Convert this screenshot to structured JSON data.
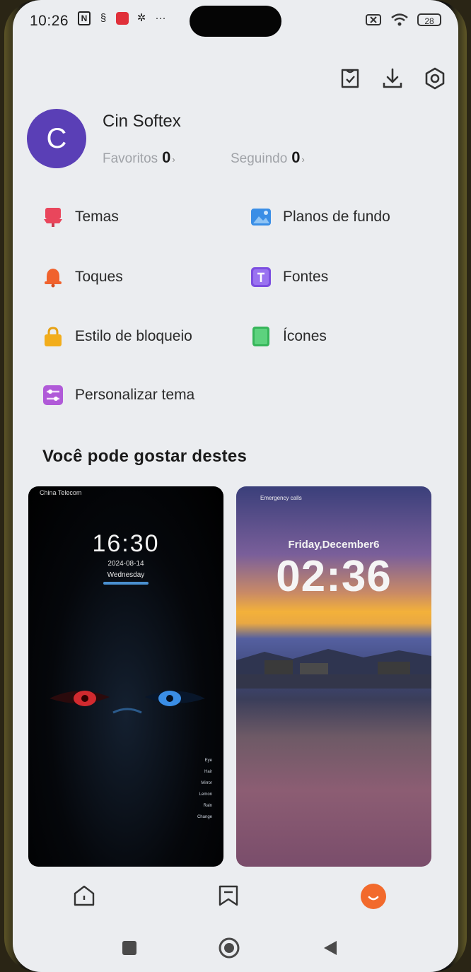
{
  "status_bar": {
    "time": "10:26",
    "battery": "28",
    "dots": "···"
  },
  "profile": {
    "avatar_letter": "C",
    "name": "Cin Softex",
    "favorites_label": "Favoritos",
    "favorites_count": "0",
    "following_label": "Seguindo",
    "following_count": "0"
  },
  "menu": {
    "items": [
      {
        "label": "Temas",
        "icon": "theme-icon",
        "color": "#e9465c"
      },
      {
        "label": "Planos de fundo",
        "icon": "wallpaper-icon",
        "color": "#3a8ee6"
      },
      {
        "label": "Toques",
        "icon": "bell-icon",
        "color": "#f0622d"
      },
      {
        "label": "Fontes",
        "icon": "font-icon",
        "color": "#7c4ee0"
      },
      {
        "label": "Estilo de bloqueio",
        "icon": "lock-icon",
        "color": "#f2ad1b"
      },
      {
        "label": "Ícones",
        "icon": "icons-icon",
        "color": "#36b55a"
      },
      {
        "label": "Personalizar tema",
        "icon": "customize-icon",
        "color": "#b05ad8"
      }
    ]
  },
  "recommend": {
    "title": "Você pode gostar destes",
    "card1": {
      "carrier": "China Telecom",
      "time": "16:30",
      "date": "2024-08-14",
      "day": "Wednesday",
      "list": [
        "Eye",
        "Hair",
        "Mirror",
        "Lemon",
        "Rain",
        "Change"
      ]
    },
    "card2": {
      "carrier": "Emergency calls",
      "date": "Friday,December6",
      "time": "02:36"
    }
  },
  "colors": {
    "accent": "#f26a2c",
    "avatar": "#5a3fb6"
  }
}
